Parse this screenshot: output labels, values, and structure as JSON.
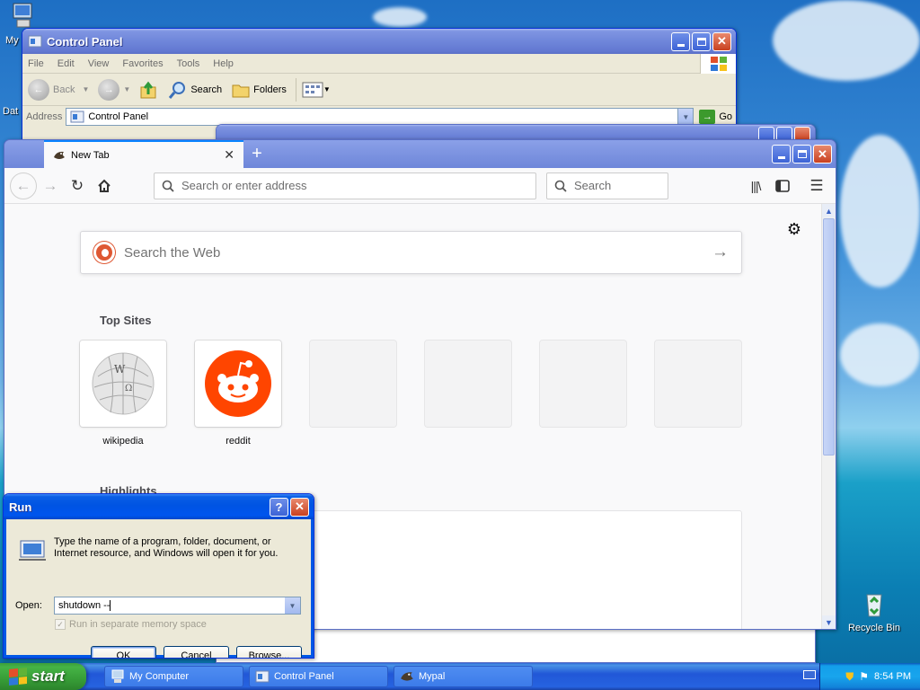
{
  "desktop": {
    "icons": [
      {
        "label": "My",
        "icon": "my-computer-icon"
      },
      {
        "label": "Dat",
        "icon": "data-icon"
      },
      {
        "label": "Recycle Bin",
        "icon": "recycle-bin-icon"
      }
    ]
  },
  "control_panel": {
    "title": "Control Panel",
    "menu": [
      "File",
      "Edit",
      "View",
      "Favorites",
      "Tools",
      "Help"
    ],
    "toolbar": {
      "back": "Back",
      "search": "Search",
      "folders": "Folders"
    },
    "address_label": "Address",
    "address_value": "Control Panel",
    "go_label": "Go"
  },
  "browser": {
    "tab_title": "New Tab",
    "url_placeholder": "Search or enter address",
    "search_placeholder": "Search",
    "web_search_placeholder": "Search the Web",
    "top_sites_heading": "Top Sites",
    "highlights_heading": "Highlights",
    "top_sites": [
      {
        "label": "wikipedia",
        "icon": "wikipedia-icon"
      },
      {
        "label": "reddit",
        "icon": "reddit-icon"
      },
      {
        "label": ""
      },
      {
        "label": ""
      },
      {
        "label": ""
      },
      {
        "label": ""
      }
    ]
  },
  "run_dialog": {
    "title": "Run",
    "description": "Type the name of a program, folder, document, or Internet resource, and Windows will open it for you.",
    "open_label": "Open:",
    "open_value": "shutdown --",
    "checkbox_label": "Run in separate memory space",
    "checkbox_checked": true,
    "ok_label": "OK",
    "cancel_label": "Cancel",
    "browse_label": "Browse..."
  },
  "taskbar": {
    "start_label": "start",
    "items": [
      {
        "label": "My Computer",
        "icon": "my-computer-icon"
      },
      {
        "label": "Control Panel",
        "icon": "control-panel-icon"
      },
      {
        "label": "Mypal",
        "icon": "mypal-icon"
      }
    ],
    "clock": "8:54 PM"
  },
  "colors": {
    "xp_blue": "#0054e3",
    "start_green": "#3c9d3c",
    "firefox_blue": "#0a84ff",
    "reddit_orange": "#ff4500",
    "close_red": "#c9401f"
  }
}
